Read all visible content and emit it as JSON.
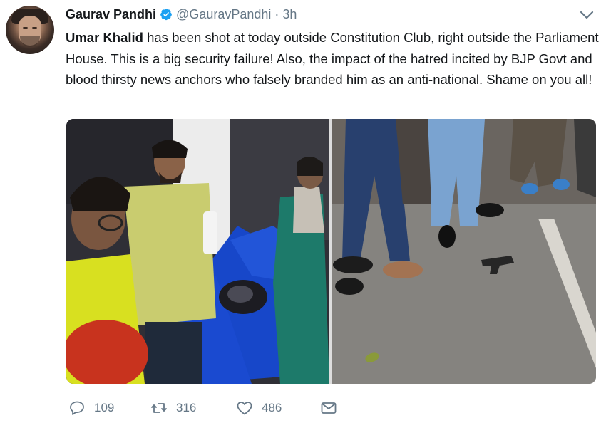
{
  "author": {
    "name": "Gaurav Pandhi",
    "handle": "@GauravPandhi",
    "separator": "·",
    "time": "3h",
    "verified": true
  },
  "tweet": {
    "mention": "Umar Khalid",
    "body": " has been shot at today outside Constitution Club, right outside the Parliament House. This is a big security failure! Also, the impact of the hatred incited by BJP Govt and blood thirsty news anchors who falsely branded him as an anti-national. Shame on you all!"
  },
  "media": [
    {
      "alt": "photo-left"
    },
    {
      "alt": "photo-right"
    }
  ],
  "actions": {
    "replies": "109",
    "retweets": "316",
    "likes": "486"
  },
  "colors": {
    "text": "#14171a",
    "secondary": "#657786",
    "verified": "#1da1f2"
  },
  "icons": [
    "verified-badge-icon",
    "chevron-down-icon",
    "reply-icon",
    "retweet-icon",
    "like-icon",
    "direct-message-icon"
  ]
}
